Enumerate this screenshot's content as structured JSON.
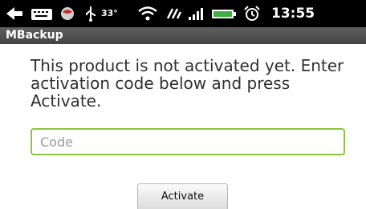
{
  "status_bar": {
    "icons": [
      "back-arrow-icon",
      "keyboard-icon",
      "notification-icon",
      "usb-icon",
      "wifi-icon",
      "sync-icon",
      "signal-icon",
      "battery-icon",
      "alarm-clock-icon"
    ],
    "temperature": "33°",
    "time": "13:55"
  },
  "app_title": "MBackup",
  "message": "This product is not activated yet. Enter activation code below and press Activate.",
  "code_input": {
    "placeholder": "Code",
    "value": ""
  },
  "activate_button": {
    "label": "Activate"
  },
  "colors": {
    "status_bar": "#000000",
    "title_bar": "#555555",
    "input_border": "#8cc63e",
    "text": "#303030"
  }
}
